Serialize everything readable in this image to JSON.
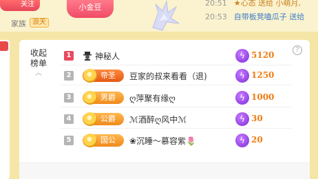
{
  "top": {
    "left_button": "关注",
    "coin_button": "小金豆",
    "family_label": "家族",
    "family_tag": "浪天",
    "chat": [
      {
        "time": "20:51",
        "message": "★心态 送给 小萌月,"
      },
      {
        "time": "20:53",
        "message": "自带板凳嗑瓜子 送给"
      }
    ]
  },
  "panel": {
    "collapse_label": "收起\n榜单",
    "help_label": "?",
    "rows": [
      {
        "rank": "1",
        "badge": "",
        "name": "神秘人",
        "score": "5120",
        "rank_color": "#e84a5f"
      },
      {
        "rank": "2",
        "badge": "帝圣",
        "name": "豆家的叔来看看（退)",
        "score": "1250",
        "rank_color": "#b5b5b5"
      },
      {
        "rank": "3",
        "badge": "男爵",
        "name": "ღ萍聚有缘ღ",
        "score": "1000",
        "rank_color": "#b5b5b5"
      },
      {
        "rank": "4",
        "badge": "公爵",
        "name": "ℳ酒醉ღ风中ℳ",
        "score": "30",
        "rank_color": "#b5b5b5"
      },
      {
        "rank": "5",
        "badge": "国公",
        "name": "❀沉睡～慕容紫🌷",
        "score": "20",
        "rank_color": "#b5b5b5"
      }
    ]
  }
}
